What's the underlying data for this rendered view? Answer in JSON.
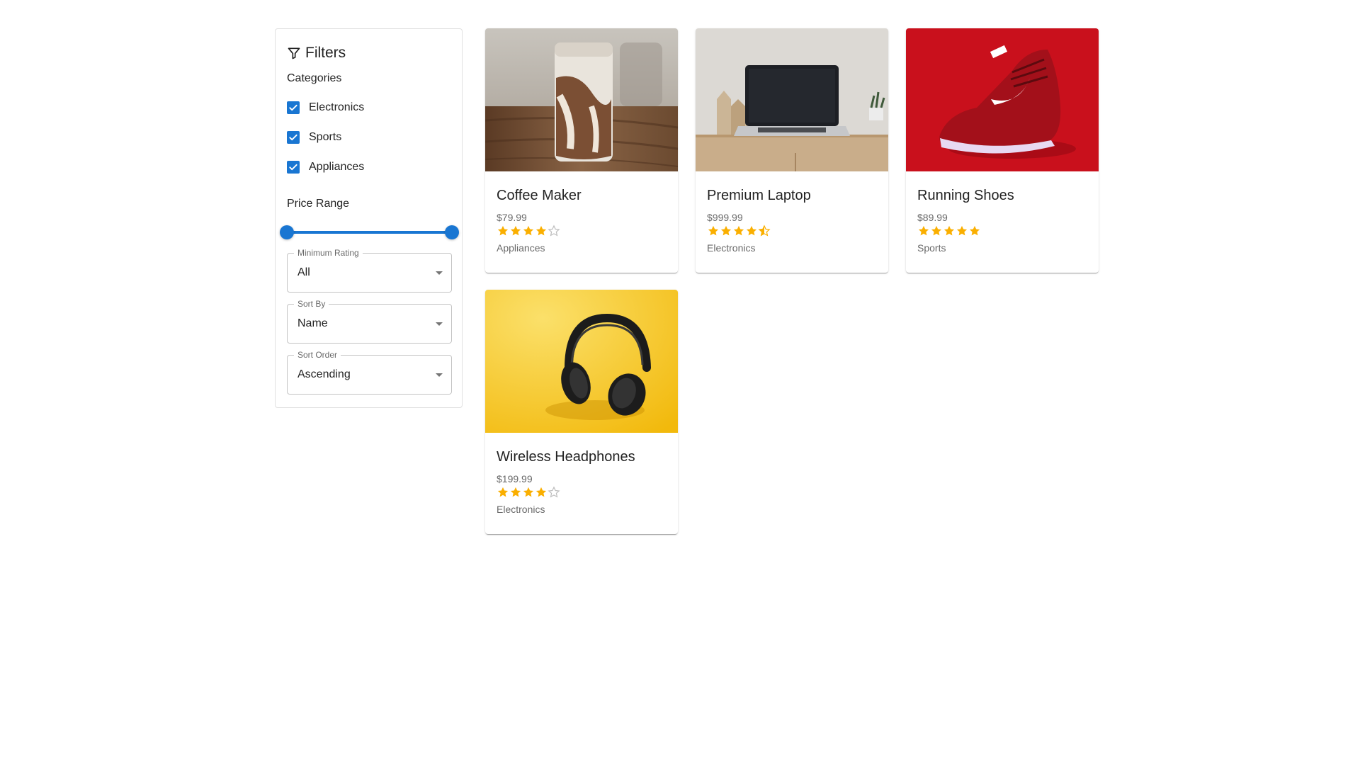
{
  "filters": {
    "title": "Filters",
    "icon": "filter-icon",
    "categories_label": "Categories",
    "categories": [
      {
        "label": "Electronics",
        "checked": true
      },
      {
        "label": "Sports",
        "checked": true
      },
      {
        "label": "Appliances",
        "checked": true
      }
    ],
    "price_range_label": "Price Range",
    "price_range": {
      "low_fraction": 0.0,
      "high_fraction": 1.0
    },
    "min_rating": {
      "legend": "Minimum Rating",
      "value": "All"
    },
    "sort_by": {
      "legend": "Sort By",
      "value": "Name"
    },
    "sort_order": {
      "legend": "Sort Order",
      "value": "Ascending"
    }
  },
  "colors": {
    "accent": "#1976d2",
    "star": "#faaf00",
    "star_empty": "#bdbdbd"
  },
  "products": [
    {
      "name": "Coffee Maker",
      "price": "$79.99",
      "rating": 4,
      "category": "Appliances",
      "image": "iced-coffee-glass-image"
    },
    {
      "name": "Premium Laptop",
      "price": "$999.99",
      "rating": 4.5,
      "category": "Electronics",
      "image": "laptop-on-desk-image"
    },
    {
      "name": "Running Shoes",
      "price": "$89.99",
      "rating": 5,
      "category": "Sports",
      "image": "red-running-shoe-image"
    },
    {
      "name": "Wireless Headphones",
      "price": "$199.99",
      "rating": 4,
      "category": "Electronics",
      "image": "headphones-on-yellow-image"
    }
  ]
}
